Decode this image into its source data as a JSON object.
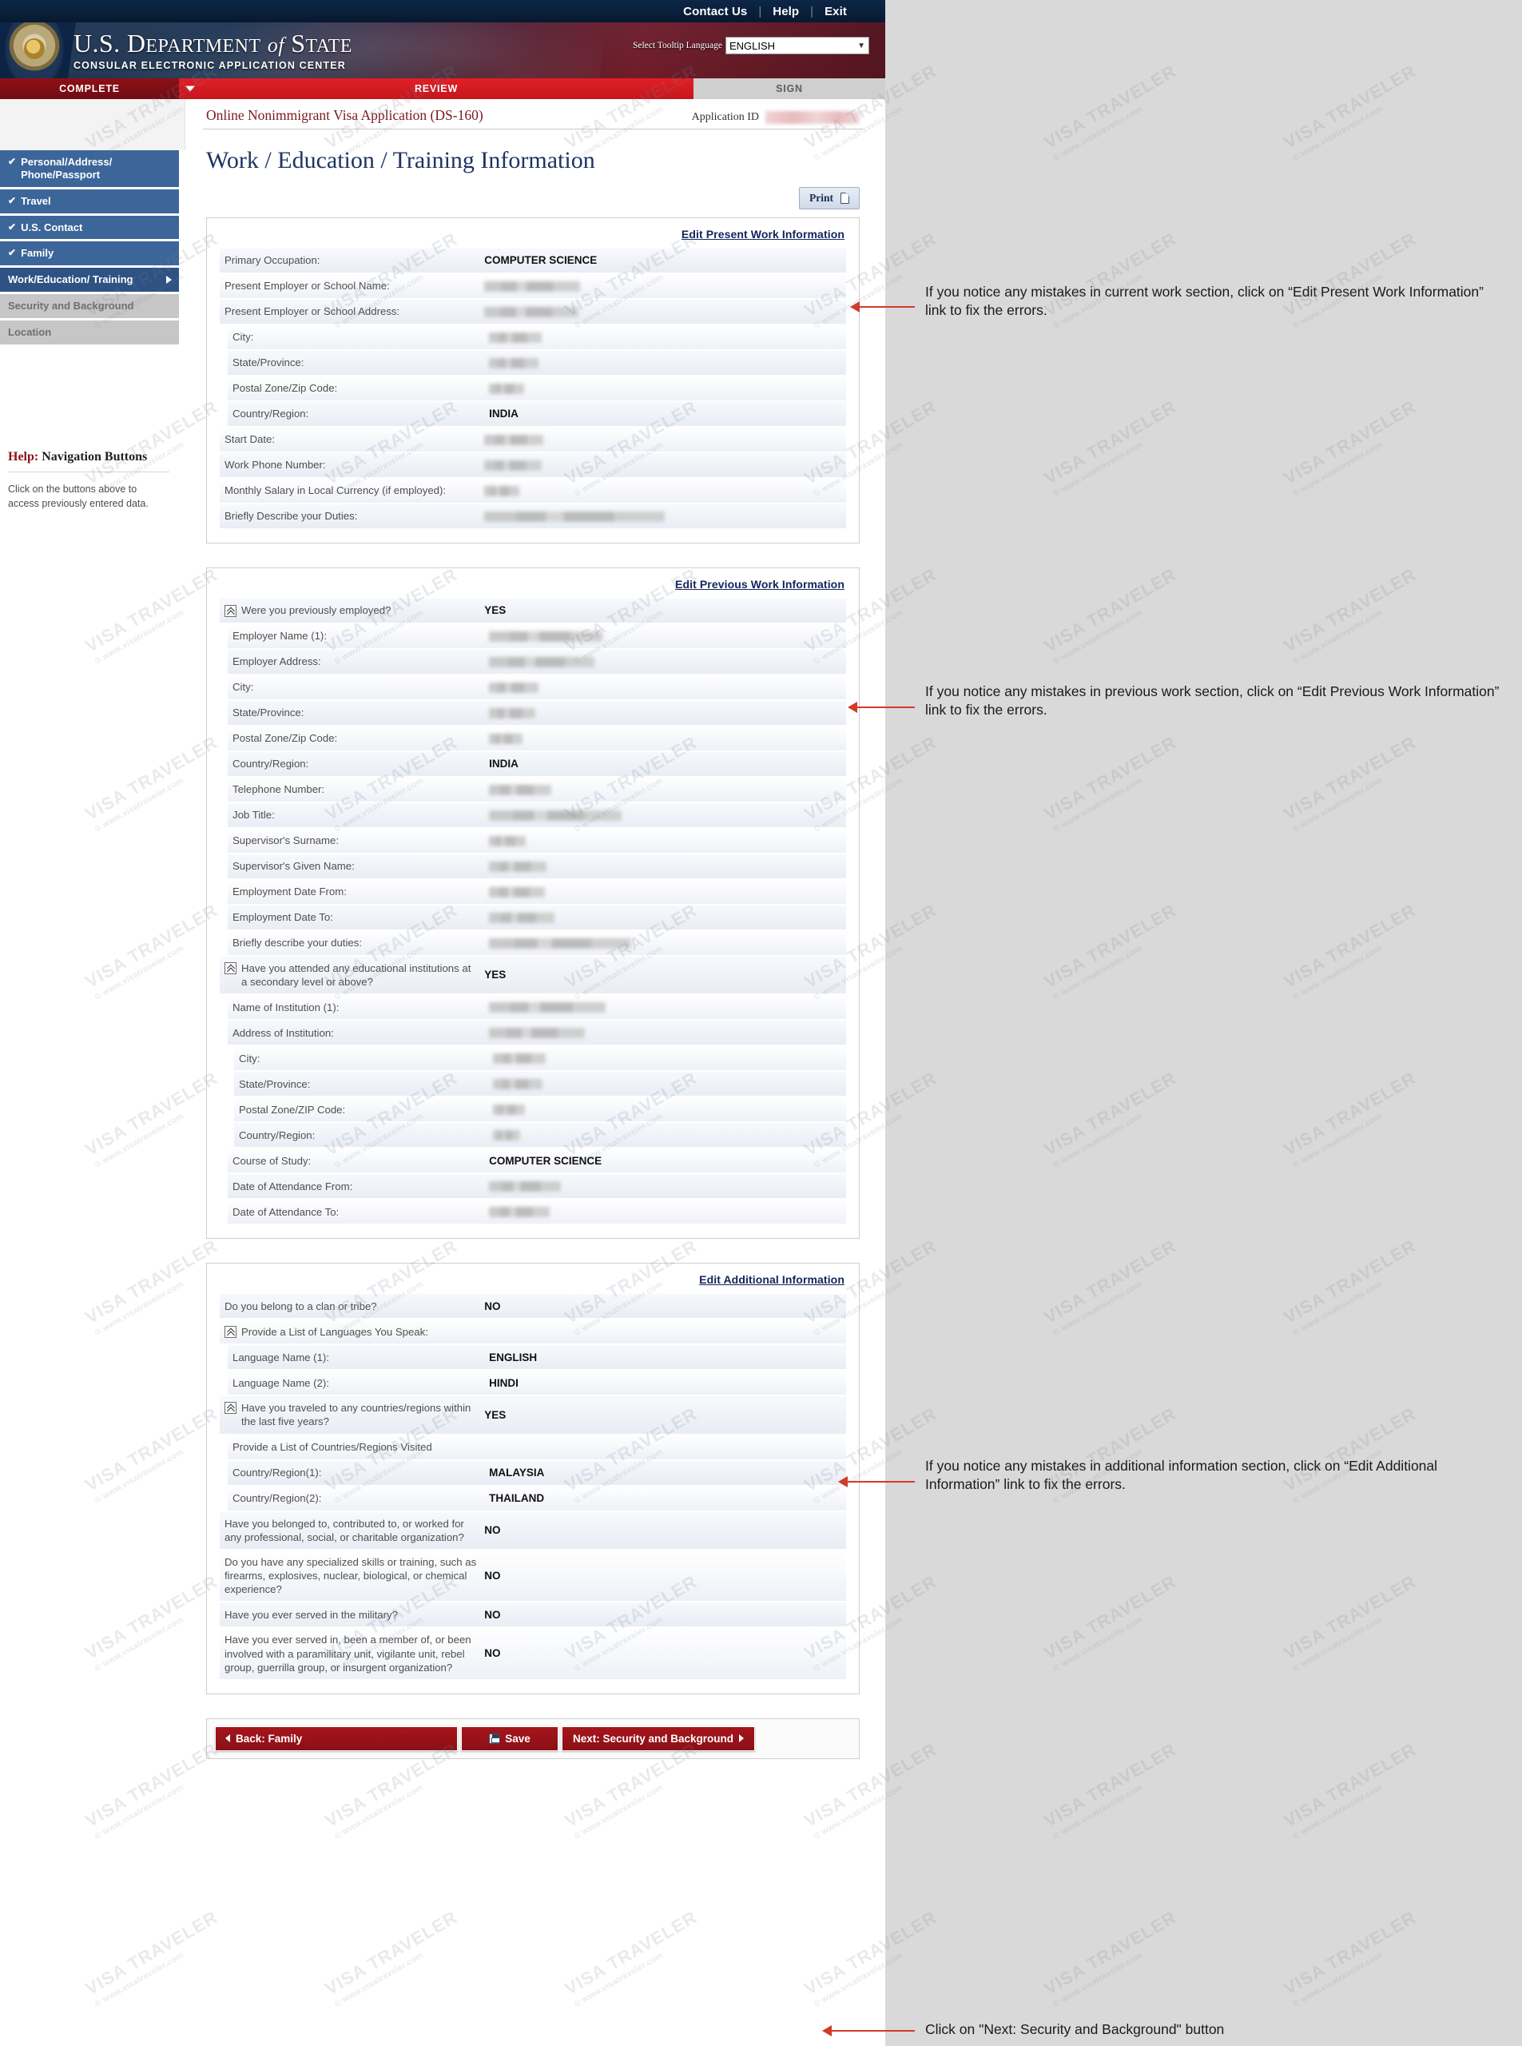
{
  "utility_bar": {
    "links": [
      "Contact Us",
      "Help",
      "Exit"
    ]
  },
  "banner": {
    "department_title_main": "U.S. D",
    "department_title": "U.S. DEPARTMENT of STATE",
    "department_subtitle": "CONSULAR ELECTRONIC APPLICATION CENTER",
    "tooltip_language_label": "Select Tooltip Language",
    "tooltip_language_value": "ENGLISH",
    "seal_icon": "us-department-of-state-seal-icon",
    "dropdown_icon": "chevron-down-icon"
  },
  "steps": [
    {
      "label": "COMPLETE",
      "state": "done"
    },
    {
      "label": "REVIEW",
      "state": "active"
    },
    {
      "label": "SIGN",
      "state": "pending"
    }
  ],
  "sidebar": {
    "items": [
      {
        "label": "Personal/Address/ Phone/Passport",
        "state": "complete",
        "icon": "check-icon"
      },
      {
        "label": "Travel",
        "state": "complete",
        "icon": "check-icon"
      },
      {
        "label": "U.S. Contact",
        "state": "complete",
        "icon": "check-icon"
      },
      {
        "label": "Family",
        "state": "complete",
        "icon": "check-icon"
      },
      {
        "label": "Work/Education/ Training",
        "state": "current",
        "icon": "caret-right-icon"
      },
      {
        "label": "Security and Background",
        "state": "disabled",
        "icon": ""
      },
      {
        "label": "Location",
        "state": "disabled",
        "icon": ""
      }
    ],
    "help": {
      "title_highlight": "Help:",
      "title_rest": " Navigation Buttons",
      "body": "Click on the buttons above to access previously entered data."
    }
  },
  "header": {
    "app_name": "Online Nonimmigrant Visa Application (DS-160)",
    "application_id_label": "Application ID",
    "application_id_value": "",
    "page_title": "Work / Education / Training Information",
    "print_label": "Print",
    "print_icon": "document-icon"
  },
  "sections": [
    {
      "id": "present-work",
      "edit_link": "Edit Present Work Information",
      "rows": [
        {
          "label": "Primary Occupation:",
          "value": "COMPUTER SCIENCE",
          "redacted": false,
          "indent": 0
        },
        {
          "label": "Present Employer or School Name:",
          "value": "",
          "redacted": true,
          "redact_width": 120,
          "indent": 0
        },
        {
          "label": "Present Employer or School Address:",
          "value": "",
          "redacted": true,
          "redact_width": 118,
          "indent": 0
        },
        {
          "label": "City:",
          "value": "",
          "redacted": true,
          "redact_width": 66,
          "indent": 1
        },
        {
          "label": "State/Province:",
          "value": "",
          "redacted": true,
          "redact_width": 62,
          "indent": 1
        },
        {
          "label": "Postal Zone/Zip Code:",
          "value": "",
          "redacted": true,
          "redact_width": 44,
          "indent": 1
        },
        {
          "label": "Country/Region:",
          "value": "INDIA",
          "redacted": false,
          "indent": 1
        },
        {
          "label": "Start Date:",
          "value": "",
          "redacted": true,
          "redact_width": 74,
          "indent": 0
        },
        {
          "label": "Work Phone Number:",
          "value": "",
          "redacted": true,
          "redact_width": 72,
          "indent": 0
        },
        {
          "label": "Monthly Salary in Local Currency (if employed):",
          "value": "",
          "redacted": true,
          "redact_width": 44,
          "indent": 0,
          "tall": true
        },
        {
          "label": "Briefly Describe your Duties:",
          "value": "",
          "redacted": true,
          "redact_width": 226,
          "indent": 0,
          "tall": true
        }
      ]
    },
    {
      "id": "previous-work",
      "edit_link": "Edit Previous Work Information",
      "rows": [
        {
          "label": "Were you previously employed?",
          "value": "YES",
          "redacted": false,
          "indent": 0,
          "tip": true
        },
        {
          "label": "Employer Name (1):",
          "value": "",
          "redacted": true,
          "redact_width": 142,
          "indent": 1
        },
        {
          "label": "Employer Address:",
          "value": "",
          "redacted": true,
          "redact_width": 132,
          "indent": 1
        },
        {
          "label": "City:",
          "value": "",
          "redacted": true,
          "redact_width": 62,
          "indent": 1
        },
        {
          "label": "State/Province:",
          "value": "",
          "redacted": true,
          "redact_width": 58,
          "indent": 1
        },
        {
          "label": "Postal Zone/Zip Code:",
          "value": "",
          "redacted": true,
          "redact_width": 42,
          "indent": 1
        },
        {
          "label": "Country/Region:",
          "value": "INDIA",
          "redacted": false,
          "indent": 1
        },
        {
          "label": "Telephone Number:",
          "value": "",
          "redacted": true,
          "redact_width": 78,
          "indent": 1
        },
        {
          "label": "Job Title:",
          "value": "",
          "redacted": true,
          "redact_width": 166,
          "indent": 1
        },
        {
          "label": "Supervisor's Surname:",
          "value": "",
          "redacted": true,
          "redact_width": 46,
          "indent": 1
        },
        {
          "label": "Supervisor's Given Name:",
          "value": "",
          "redacted": true,
          "redact_width": 72,
          "indent": 1
        },
        {
          "label": "Employment Date From:",
          "value": "",
          "redacted": true,
          "redact_width": 70,
          "indent": 1
        },
        {
          "label": "Employment Date To:",
          "value": "",
          "redacted": true,
          "redact_width": 82,
          "indent": 1
        },
        {
          "label": "Briefly describe your duties:",
          "value": "",
          "redacted": true,
          "redact_width": 178,
          "indent": 1,
          "tall": true
        },
        {
          "label": "Have you attended any educational institutions at a secondary level or above?",
          "value": "YES",
          "redacted": false,
          "indent": 0,
          "tip": true,
          "tall": true
        },
        {
          "label": "Name of Institution (1):",
          "value": "",
          "redacted": true,
          "redact_width": 146,
          "indent": 1
        },
        {
          "label": "Address of Institution:",
          "value": "",
          "redacted": true,
          "redact_width": 120,
          "indent": 1
        },
        {
          "label": "City:",
          "value": "",
          "redacted": true,
          "redact_width": 66,
          "indent": 2
        },
        {
          "label": "State/Province:",
          "value": "",
          "redacted": true,
          "redact_width": 62,
          "indent": 2
        },
        {
          "label": "Postal Zone/ZIP Code:",
          "value": "",
          "redacted": true,
          "redact_width": 40,
          "indent": 2
        },
        {
          "label": "Country/Region:",
          "value": "",
          "redacted": true,
          "redact_width": 34,
          "indent": 2
        },
        {
          "label": "Course of Study:",
          "value": "COMPUTER SCIENCE",
          "redacted": false,
          "indent": 1
        },
        {
          "label": "Date of Attendance From:",
          "value": "",
          "redacted": true,
          "redact_width": 90,
          "indent": 1
        },
        {
          "label": "Date of Attendance To:",
          "value": "",
          "redacted": true,
          "redact_width": 76,
          "indent": 1
        }
      ]
    },
    {
      "id": "additional-information",
      "edit_link": "Edit Additional Information",
      "rows": [
        {
          "label": "Do you belong to a clan or tribe?",
          "value": "NO",
          "redacted": false,
          "indent": 0
        },
        {
          "label": "Provide a List of Languages You Speak:",
          "value": "",
          "redacted": false,
          "indent": 0,
          "tip": true
        },
        {
          "label": "Language Name (1):",
          "value": "ENGLISH",
          "redacted": false,
          "indent": 1
        },
        {
          "label": "Language Name (2):",
          "value": "HINDI",
          "redacted": false,
          "indent": 1
        },
        {
          "label": "Have you traveled to any countries/regions within the last five years?",
          "value": "YES",
          "redacted": false,
          "indent": 0,
          "tip": true,
          "tall": true
        },
        {
          "label": "Provide a List of Countries/Regions Visited",
          "value": "",
          "redacted": false,
          "indent": 1
        },
        {
          "label": "Country/Region(1):",
          "value": "MALAYSIA",
          "redacted": false,
          "indent": 1
        },
        {
          "label": "Country/Region(2):",
          "value": "THAILAND",
          "redacted": false,
          "indent": 1
        },
        {
          "label": "Have you belonged to, contributed to, or worked for any professional, social, or charitable organization?",
          "value": "NO",
          "redacted": false,
          "indent": 0,
          "tall": true
        },
        {
          "label": "Do you have any specialized skills or training, such as firearms, explosives, nuclear, biological, or chemical experience?",
          "value": "NO",
          "redacted": false,
          "indent": 0,
          "tall": true
        },
        {
          "label": "Have you ever served in the military?",
          "value": "NO",
          "redacted": false,
          "indent": 0
        },
        {
          "label": "Have you ever served in, been a member of, or been involved with a paramilitary unit, vigilante unit, rebel group, guerrilla group, or insurgent organization?",
          "value": "NO",
          "redacted": false,
          "indent": 0,
          "tall": true
        }
      ]
    }
  ],
  "nav_buttons": {
    "back_label": "Back: Family",
    "save_label": "Save",
    "next_label": "Next: Security and Background",
    "back_icon": "caret-left-icon",
    "save_icon": "floppy-disk-icon",
    "next_icon": "caret-right-icon"
  },
  "annotations": [
    {
      "id": "anno-present",
      "text": "If you notice any mistakes in current work section, click on “Edit Present Work Information” link to fix the errors."
    },
    {
      "id": "anno-previous",
      "text": "If you notice any mistakes in previous work section, click on “Edit Previous Work Information” link to fix the errors."
    },
    {
      "id": "anno-additional",
      "text": "If you notice any mistakes in additional information section, click on “Edit Additional Information” link to fix the errors."
    },
    {
      "id": "anno-next",
      "text": "Click on \"Next: Security and Background\" button"
    }
  ],
  "watermark": {
    "big": "VISA TRAVELER",
    "small": "© www.visatraveler.com"
  },
  "colors": {
    "accent_red": "#c4161c",
    "nav_blue": "#3c6699",
    "title_blue": "#1d3462",
    "arrow_red": "#d33a28"
  }
}
